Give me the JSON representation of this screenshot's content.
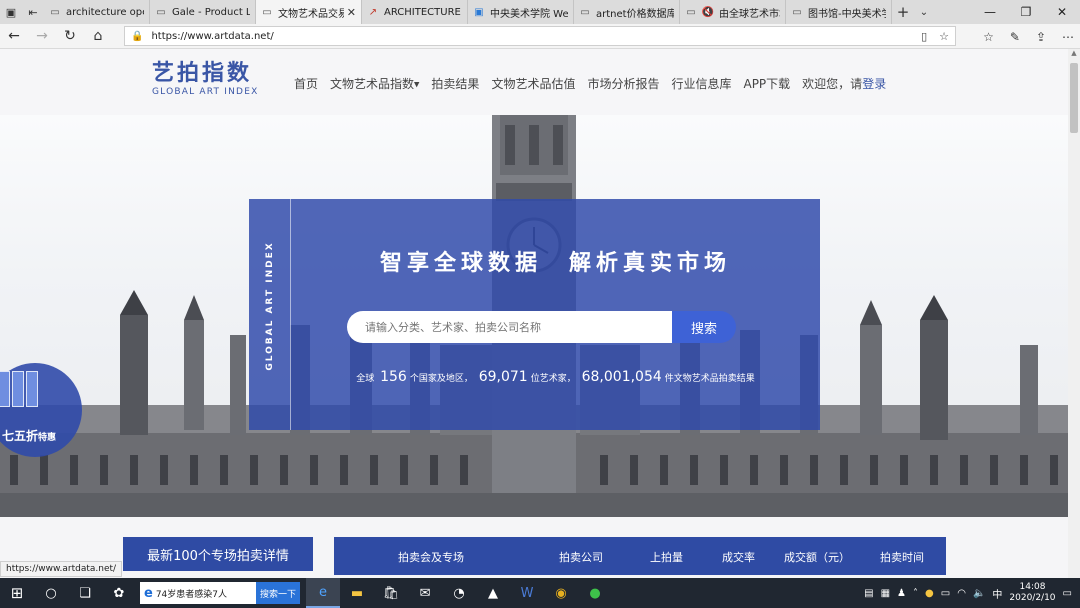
{
  "browser": {
    "tabs": [
      {
        "title": "architecture open li",
        "icon": "page-icon",
        "active": false
      },
      {
        "title": "Gale - Product Logi",
        "icon": "page-icon",
        "active": false
      },
      {
        "title": "文物艺术品交易",
        "icon": "page-icon",
        "active": true
      },
      {
        "title": "ARCHITECTURE OP",
        "icon": "chart-icon",
        "active": false
      },
      {
        "title": "中央美术学院 Web",
        "icon": "bookmark-icon",
        "active": false
      },
      {
        "title": "artnet价格数据库—",
        "icon": "page-icon",
        "active": false
      },
      {
        "title": "由全球艺术市场",
        "icon": "mute-icon",
        "active": false
      },
      {
        "title": "图书馆-中央美术学",
        "icon": "page-icon",
        "active": false
      }
    ],
    "url": "https://www.artdata.net/",
    "status_url": "https://www.artdata.net/"
  },
  "site": {
    "logo_cn": "艺拍指数",
    "logo_en": "GLOBAL ART INDEX",
    "nav": {
      "home": "首页",
      "index": "文物艺术品指数",
      "results": "拍卖结果",
      "valuation": "文物艺术品估值",
      "reports": "市场分析报告",
      "database": "行业信息库",
      "app": "APP下载",
      "welcome": "欢迎您，请",
      "login": "登录"
    },
    "hero": {
      "side_text": "GLOBAL ART INDEX",
      "slogan": "智享全球数据　解析真实市场",
      "search_placeholder": "请输入分类、艺术家、拍卖公司名称",
      "search_button": "搜索",
      "stats": {
        "prefix": "全球",
        "countries": "156",
        "countries_unit": "个国家及地区，",
        "artists": "69,071",
        "artists_unit": "位艺术家，",
        "lots": "68,001,054",
        "lots_unit": "件文物艺术品拍卖结果"
      }
    },
    "promo": {
      "label": "七五折",
      "sub": "特惠"
    },
    "latest_title": "最新100个专场拍卖详情",
    "table_headers": [
      "拍卖会及专场",
      "拍卖公司",
      "上拍量",
      "成交率",
      "成交额（元）",
      "拍卖时间"
    ]
  },
  "taskbar": {
    "search_text": "74岁患者感染7人",
    "search_button": "搜索一下",
    "ime": "中",
    "time": "14:08",
    "date": "2020/2/10"
  }
}
